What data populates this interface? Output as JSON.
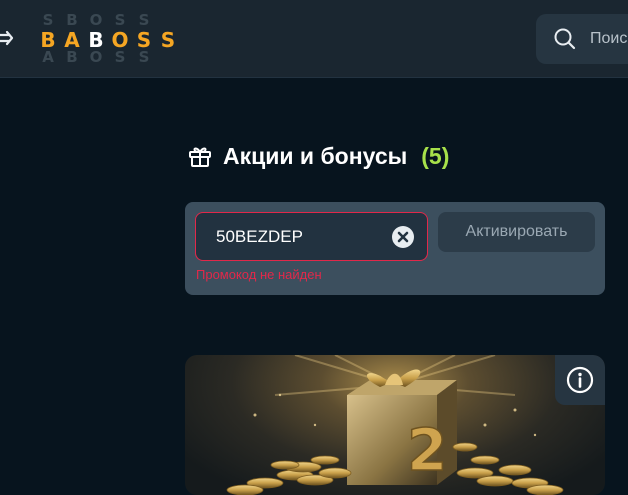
{
  "header": {
    "logo": {
      "ghost_letters": [
        "S",
        "B",
        "O",
        "S",
        "S"
      ],
      "letters": [
        "B",
        "A",
        "B",
        "O",
        "S",
        "S"
      ],
      "ghost_bottom": [
        "A",
        "B",
        "O",
        "S",
        "S"
      ]
    },
    "search": {
      "placeholder": "Поиск"
    }
  },
  "page": {
    "title": "Акции и бонусы",
    "count": "(5)"
  },
  "promo": {
    "code_value": "50BEZDEP",
    "activate_label": "Активировать",
    "error": "Промокод не найден"
  },
  "colors": {
    "accent": "#f5a623",
    "count": "#a7e14a",
    "error": "#e2284a",
    "background": "#07141e",
    "card": "#3c4f5e"
  },
  "icons": {
    "menu": "arrow-right-icon",
    "search": "search-icon",
    "gift": "gift-icon",
    "clear": "close-circle-icon",
    "info": "info-icon"
  }
}
